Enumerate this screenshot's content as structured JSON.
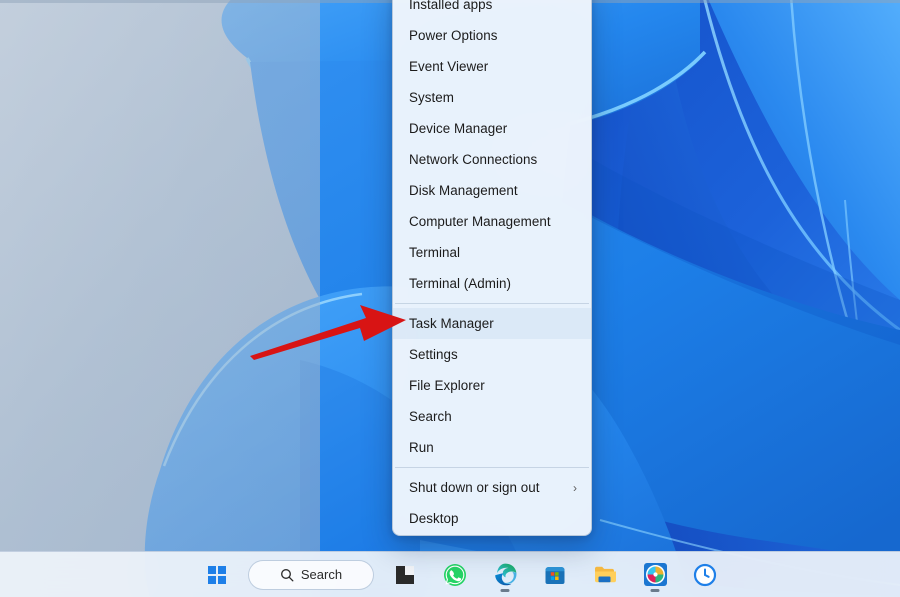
{
  "window": {
    "os": "Windows 11",
    "wallpaper_name": "bloom-abstract-blue"
  },
  "context_menu": {
    "name": "win-x-power-user-menu",
    "items": [
      {
        "label": "Installed apps",
        "type": "item",
        "highlighted": false
      },
      {
        "label": "Power Options",
        "type": "item",
        "highlighted": false
      },
      {
        "label": "Event Viewer",
        "type": "item",
        "highlighted": false
      },
      {
        "label": "System",
        "type": "item",
        "highlighted": false
      },
      {
        "label": "Device Manager",
        "type": "item",
        "highlighted": false
      },
      {
        "label": "Network Connections",
        "type": "item",
        "highlighted": false
      },
      {
        "label": "Disk Management",
        "type": "item",
        "highlighted": false
      },
      {
        "label": "Computer Management",
        "type": "item",
        "highlighted": false
      },
      {
        "label": "Terminal",
        "type": "item",
        "highlighted": false
      },
      {
        "label": "Terminal (Admin)",
        "type": "item",
        "highlighted": false
      },
      {
        "label": "",
        "type": "separator",
        "highlighted": false
      },
      {
        "label": "Task Manager",
        "type": "item",
        "highlighted": true
      },
      {
        "label": "Settings",
        "type": "item",
        "highlighted": false
      },
      {
        "label": "File Explorer",
        "type": "item",
        "highlighted": false
      },
      {
        "label": "Search",
        "type": "item",
        "highlighted": false
      },
      {
        "label": "Run",
        "type": "item",
        "highlighted": false
      },
      {
        "label": "",
        "type": "separator",
        "highlighted": false
      },
      {
        "label": "Shut down or sign out",
        "type": "submenu",
        "highlighted": false,
        "chevron": "›"
      },
      {
        "label": "Desktop",
        "type": "item",
        "highlighted": false
      }
    ]
  },
  "annotation": {
    "arrow_color": "#D81414",
    "points_at": "Task Manager"
  },
  "taskbar": {
    "search": {
      "label": "Search",
      "icon": "search-icon"
    },
    "items": [
      {
        "name": "start-button",
        "icon": "windows-logo-icon",
        "active": false
      },
      {
        "name": "search-pill",
        "icon": "search-icon",
        "active": false
      },
      {
        "name": "task-view-button",
        "icon": "task-view-icon",
        "active": false
      },
      {
        "name": "whatsapp-button",
        "icon": "whatsapp-icon",
        "active": false
      },
      {
        "name": "edge-button",
        "icon": "microsoft-edge-icon",
        "active": true
      },
      {
        "name": "store-button",
        "icon": "microsoft-store-icon",
        "active": false
      },
      {
        "name": "file-explorer-button",
        "icon": "folder-icon",
        "active": false
      },
      {
        "name": "slack-button",
        "icon": "slack-icon",
        "active": true
      },
      {
        "name": "clock-app-button",
        "icon": "clock-icon",
        "active": false
      }
    ]
  },
  "colors": {
    "menu_bg": "#F1F6FC",
    "taskbar_bg": "#EEF3FA",
    "accent_blue": "#1E7FE8",
    "arrow_red": "#D81414"
  }
}
